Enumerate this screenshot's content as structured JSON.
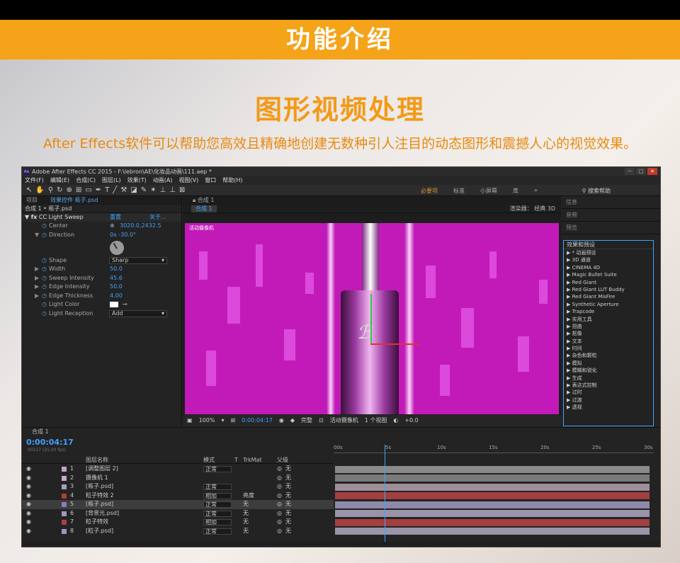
{
  "page": {
    "banner_title": "功能介绍",
    "heading": "图形视频处理",
    "description": "After Effects软件可以帮助您高效且精确地创建无数种引人注目的动态图形和震撼人心的视觉效果。"
  },
  "app": {
    "logo": "Ae",
    "title": "Adobe After Effects CC 2015 - F:\\lebron\\AE\\化妆品动画\\111.aep *",
    "menu": [
      "文件(F)",
      "编辑(E)",
      "合成(C)",
      "图层(L)",
      "效果(T)",
      "动画(A)",
      "视图(V)",
      "窗口",
      "帮助(H)"
    ],
    "workspaces": [
      "必要项",
      "标准",
      "小屏幕",
      "库"
    ],
    "search_help": "搜索帮助"
  },
  "effect_controls": {
    "tabs": [
      "项目",
      "效果控件 瓶子.psd"
    ],
    "comp_path": "合成 1 • 瓶子.psd",
    "effect_name": "CC Light Sweep",
    "reset_label": "重置",
    "about_label": "关于...",
    "props": [
      {
        "name": "Center",
        "value": "3020.0,2432.5"
      },
      {
        "name": "Direction",
        "value": "0x -30.0°"
      },
      {
        "name": "Shape",
        "value": "Sharp"
      },
      {
        "name": "Width",
        "value": "50.0"
      },
      {
        "name": "Sweep Intensity",
        "value": "45.6"
      },
      {
        "name": "Edge Intensity",
        "value": "50.0"
      },
      {
        "name": "Edge Thickness",
        "value": "4.00"
      },
      {
        "name": "Light Color",
        "value": ""
      },
      {
        "name": "Light Reception",
        "value": "Add"
      }
    ]
  },
  "viewer": {
    "tab": "合成 1",
    "comp_tag": "合成 1",
    "renderer": "渲染器：  经典 3D",
    "camera_label": "活动摄像机",
    "zoom": "100%",
    "timecode": "0:00:04:17",
    "quality": "完整",
    "camera_select": "活动摄像机",
    "views": "1 个视图",
    "exposure": "+0.0"
  },
  "right_panel": {
    "tabs": [
      "信息",
      "音频",
      "预览"
    ],
    "effects_title": "效果和预设",
    "effects": [
      "* 动画预设",
      "3D 通道",
      "CINEMA 4D",
      "Magic Bullet Suite",
      "Red Giant",
      "Red Giant LUT Buddy",
      "Red Giant MisFire",
      "Synthetic Aperture",
      "Trapcode",
      "实用工具",
      "扭曲",
      "抠像",
      "文本",
      "时间",
      "杂色和颗粒",
      "模拟",
      "模糊和锐化",
      "生成",
      "表达式控制",
      "过时",
      "过渡",
      "透视"
    ]
  },
  "timeline": {
    "tab": "合成 1",
    "timecode": "0:00:04:17",
    "fps": "00117 (25.00 fps)",
    "ruler": [
      "00s",
      "5s",
      "10s",
      "15s",
      "20s",
      "25s",
      "30s"
    ],
    "columns": {
      "name": "图层名称",
      "mode": "模式",
      "t": "T",
      "trkmat": "TrkMat",
      "parent": "父级"
    },
    "layers": [
      {
        "num": "1",
        "name": "[调整图层 2]",
        "mode": "正常",
        "trkmat": "",
        "parent": "无",
        "color": "#b9a8c8",
        "bar": "#8a8a8a"
      },
      {
        "num": "2",
        "name": "摄像机 1",
        "mode": "",
        "trkmat": "",
        "parent": "无",
        "color": "#c7a7c7",
        "bar": "#7a7a7a"
      },
      {
        "num": "3",
        "name": "[瓶子.psd]",
        "mode": "正常",
        "trkmat": "",
        "parent": "无",
        "color": "#a69fc2",
        "bar": "#9d8f98"
      },
      {
        "num": "4",
        "name": "粒子特效 2",
        "mode": "相加",
        "trkmat": "亮度",
        "parent": "无",
        "color": "#b43c3c",
        "bar": "#a24040"
      },
      {
        "num": "5",
        "name": "[瓶子.psd]",
        "mode": "正常",
        "trkmat": "无",
        "parent": "无",
        "color": "#8e7fb3",
        "bar": "#8d89a8"
      },
      {
        "num": "6",
        "name": "[背景光.psd]",
        "mode": "正常",
        "trkmat": "无",
        "parent": "无",
        "color": "#9f95c0",
        "bar": "#9a94aa"
      },
      {
        "num": "7",
        "name": "粒子特效",
        "mode": "相加",
        "trkmat": "无",
        "parent": "无",
        "color": "#b43c3c",
        "bar": "#a24040"
      },
      {
        "num": "8",
        "name": "[粒子.psd]",
        "mode": "正常",
        "trkmat": "无",
        "parent": "无",
        "color": "#9f95c0",
        "bar": "#9a94aa"
      }
    ]
  }
}
